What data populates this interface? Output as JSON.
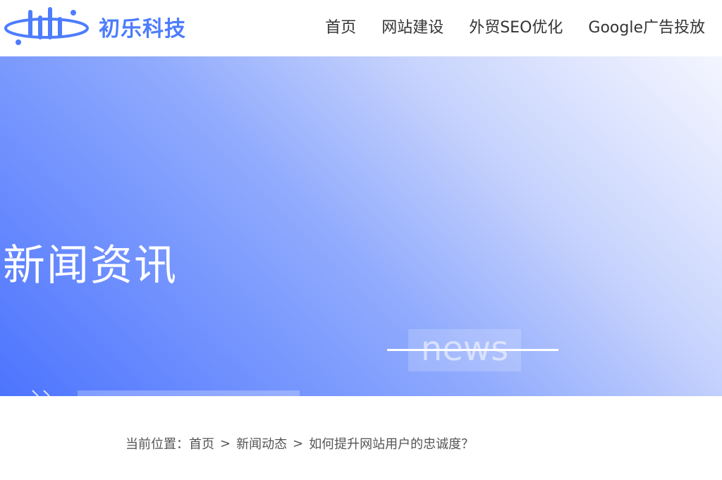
{
  "header": {
    "logo_text": "初乐科技",
    "nav": [
      "首页",
      "网站建设",
      "外贸SEO优化",
      "Google广告投放"
    ]
  },
  "banner": {
    "title": "新闻资讯",
    "tag": "news"
  },
  "breadcrumb": {
    "prefix": "当前位置：",
    "items": [
      "首页",
      "新闻动态",
      "如何提升网站用户的忠诚度？"
    ],
    "separator": ">"
  },
  "colors": {
    "brand": "#4d7cfe",
    "banner_start": "#4d74fe",
    "banner_end": "#f4f6fe"
  },
  "icons": {
    "logo": "logo-mark-icon",
    "banner_arrows": "double-chevron-icon"
  }
}
